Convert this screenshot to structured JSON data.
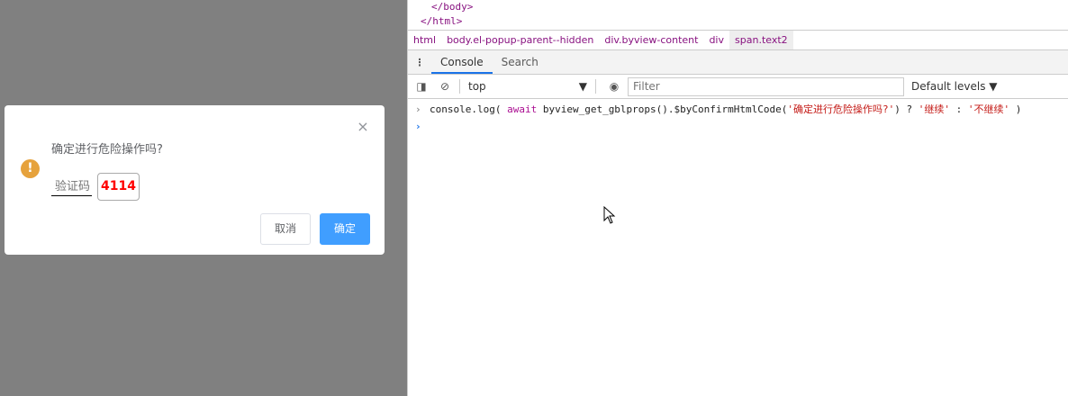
{
  "dialog": {
    "message": "确定进行危险操作吗?",
    "code_placeholder": "验证码",
    "code": "4114",
    "cancel": "取消",
    "confirm": "确定",
    "close": "×",
    "warn": "!"
  },
  "devtools": {
    "source": [
      "</body>",
      "</html>"
    ],
    "breadcrumbs": [
      "html",
      "body.el-popup-parent--hidden",
      "div.byview-content",
      "div",
      "span.text2"
    ],
    "tabs": [
      "Console",
      "Search"
    ],
    "context": "top",
    "filter_placeholder": "Filter",
    "levels": "Default levels ▼",
    "console": {
      "prefix": "console.log( ",
      "await": "await",
      "call": " byview_get_gblprops().$byConfirmHtmlCode(",
      "arg": "'确定进行危险操作吗?'",
      "mid": ") ? ",
      "a": "'继续'",
      "colon": " : ",
      "b": "'不继续'",
      "end": " )"
    }
  }
}
